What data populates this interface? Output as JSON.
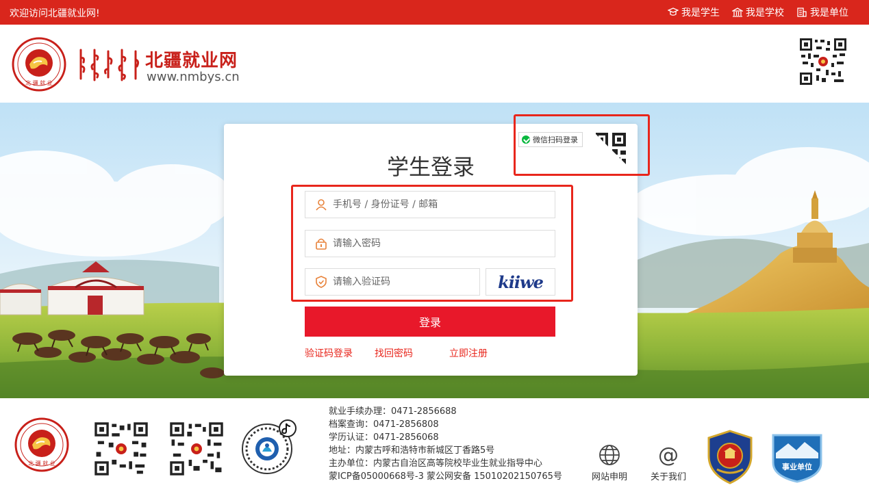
{
  "topbar": {
    "welcome": "欢迎访问北疆就业网!",
    "links": [
      {
        "label": "我是学生",
        "icon": "graduation-cap-icon"
      },
      {
        "label": "我是学校",
        "icon": "school-building-icon"
      },
      {
        "label": "我是单位",
        "icon": "office-building-icon"
      }
    ]
  },
  "header": {
    "site_name": "北疆就业网",
    "site_url": "www.nmbys.cn",
    "emblem_text": "北疆就业"
  },
  "login": {
    "title": "学生登录",
    "wechat_tag": "微信扫码登录",
    "account_placeholder": "手机号 / 身份证号 / 邮箱",
    "password_placeholder": "请输入密码",
    "captcha_placeholder": "请输入验证码",
    "captcha_text": "kiiwe",
    "submit_label": "登录",
    "links": [
      "验证码登录",
      "找回密码",
      "立即注册"
    ]
  },
  "footer": {
    "info": [
      "就业手续办理：0471-2856688",
      "档案查询：0471-2856808",
      "学历认证：0471-2856068",
      "地址：内蒙古呼和浩特市新城区丁香路5号",
      "主办单位：内蒙古自治区高等院校毕业生就业指导中心",
      "蒙ICP备05000668号-3 蒙公网安备 15010202150765号"
    ],
    "statement_label": "网站申明",
    "about_label": "关于我们",
    "unit_badge": "事业单位"
  },
  "colors": {
    "brand_red": "#d9261c",
    "button_red": "#e8182a",
    "highlight_red": "#e8261c",
    "captcha_blue": "#1e3a8a"
  }
}
